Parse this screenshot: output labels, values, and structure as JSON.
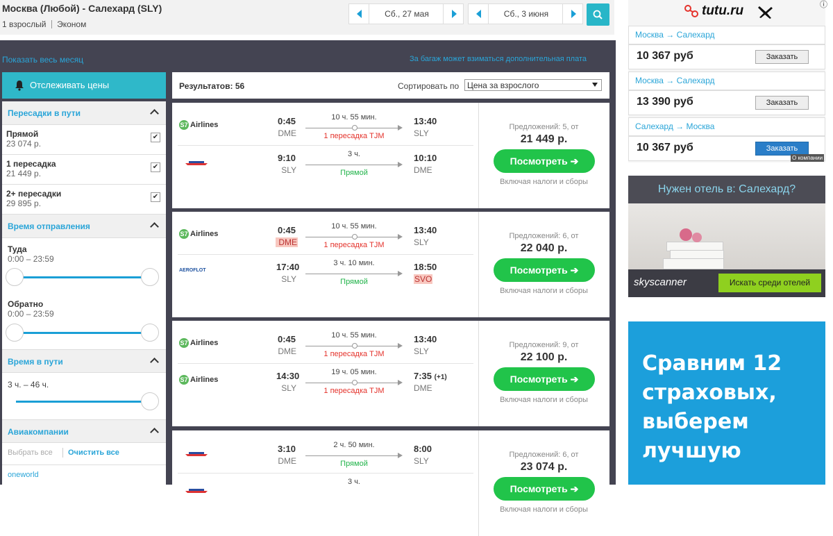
{
  "header": {
    "route_title": "Москва (Любой) - Салехард (SLY)",
    "pax": "1 взрослый",
    "cabin": "Эконом",
    "date_out": "Сб., 27 мая",
    "date_back": "Сб., 3 июня"
  },
  "links": {
    "show_month": "Показать весь месяц",
    "baggage_note": "За багаж может взиматься дополнительная плата"
  },
  "sidebar": {
    "track_prices": "Отслеживать цены",
    "stops_title": "Пересадки в пути",
    "stops": [
      {
        "label": "Прямой",
        "price": "23 074 р.",
        "checked": "✔"
      },
      {
        "label": "1 пересадка",
        "price": "21 449 р.",
        "checked": "✔"
      },
      {
        "label": "2+ пересадки",
        "price": "29 895 р.",
        "checked": "✔"
      }
    ],
    "depart_title": "Время отправления",
    "out_label": "Туда",
    "out_range": "0:00 – 23:59",
    "back_label": "Обратно",
    "back_range": "0:00 – 23:59",
    "travel_title": "Время в пути",
    "travel_range": "3 ч. – 46 ч.",
    "airlines_title": "Авиакомпании",
    "select_all": "Выбрать все",
    "clear_all": "Очистить все",
    "alliance": "oneworld"
  },
  "results": {
    "count_label": "Результатов: 56",
    "sort_label": "Сортировать по",
    "sort_value": "Цена за взрослого",
    "view_label": "Посмотреть ➔",
    "tax_label": "Включая налоги и сборы",
    "cards": [
      {
        "legs": [
          {
            "airline": "Airlines",
            "dep": "0:45",
            "dep_ap": "DME",
            "dur": "10 ч. 55 мин.",
            "stops": "1 пересадка TJM",
            "arr": "13:40",
            "arr_ap": "SLY"
          },
          {
            "airline": "",
            "dep": "9:10",
            "dep_ap": "SLY",
            "dur": "3 ч.",
            "stops": "Прямой",
            "arr": "10:10",
            "arr_ap": "DME"
          }
        ],
        "offers": "Предложений: 5, от",
        "price": "21 449 р."
      },
      {
        "legs": [
          {
            "airline": "Airlines",
            "dep": "0:45",
            "dep_ap": "DME",
            "dur": "10 ч. 55 мин.",
            "stops": "1 пересадка TJM",
            "arr": "13:40",
            "arr_ap": "SLY"
          },
          {
            "airline": "AEROFLOT",
            "dep": "17:40",
            "dep_ap": "SLY",
            "dur": "3 ч. 10 мин.",
            "stops": "Прямой",
            "arr": "18:50",
            "arr_ap": "SVO"
          }
        ],
        "offers": "Предложений: 6, от",
        "price": "22 040 р."
      },
      {
        "legs": [
          {
            "airline": "Airlines",
            "dep": "0:45",
            "dep_ap": "DME",
            "dur": "10 ч. 55 мин.",
            "stops": "1 пересадка TJM",
            "arr": "13:40",
            "arr_ap": "SLY"
          },
          {
            "airline": "Airlines",
            "dep": "14:30",
            "dep_ap": "SLY",
            "dur": "19 ч. 05 мин.",
            "stops": "1 пересадка TJM",
            "arr": "7:35",
            "arr_extra": "(+1)",
            "arr_ap": "DME"
          }
        ],
        "offers": "Предложений: 9, от",
        "price": "22 100 р."
      },
      {
        "legs": [
          {
            "airline": "",
            "dep": "3:10",
            "dep_ap": "DME",
            "dur": "2 ч. 50 мин.",
            "stops": "Прямой",
            "arr": "8:00",
            "arr_ap": "SLY"
          },
          {
            "airline": "",
            "dep": "",
            "dep_ap": "",
            "dur": "3 ч.",
            "stops": "",
            "arr": "",
            "arr_ap": ""
          }
        ],
        "offers": "Предложений: 6, от",
        "price": "23 074 р."
      }
    ]
  },
  "ads": {
    "tutu_logo": "tutu.ru",
    "tutu_items": [
      {
        "route": "Москва → Салехард",
        "price": "10 367 руб",
        "button": "Заказать"
      },
      {
        "route": "Москва → Салехард",
        "price": "13 390 руб",
        "button": "Заказать"
      },
      {
        "route": "Салехард → Москва",
        "price": "10 367 руб",
        "button": "Заказать"
      }
    ],
    "tutu_about": "О компании",
    "hotel_title": "Нужен отель в: Салехард?",
    "skyscanner": "skyscanner",
    "hotel_button": "Искать среди отелей",
    "insure_text": "Сравним 12 страховых, выберем лучшую"
  },
  "colors": {
    "accent": "#1a9fd6",
    "green": "#21c44a",
    "band": "#444452"
  }
}
